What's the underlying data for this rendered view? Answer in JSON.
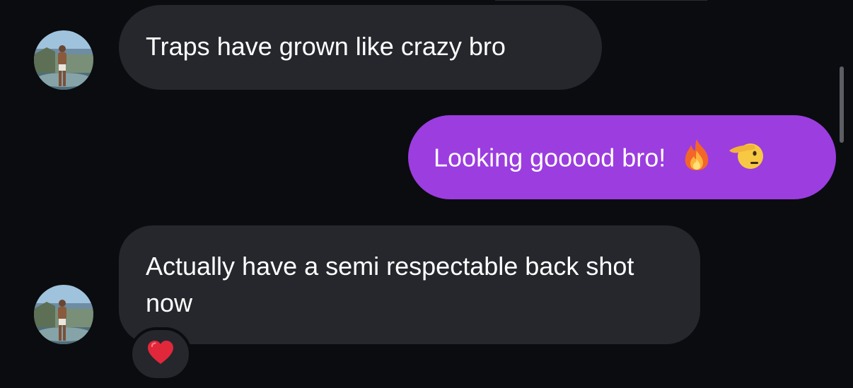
{
  "messages": [
    {
      "direction": "received",
      "text": "Traps have grown like crazy bro"
    },
    {
      "direction": "sent",
      "text": "Looking gooood bro!",
      "emojis": [
        "fire-icon",
        "saluting-face-icon"
      ]
    },
    {
      "direction": "received",
      "text": "Actually have a semi respectable back shot now",
      "reaction": "red-heart-icon"
    }
  ],
  "colors": {
    "background": "#0b0c10",
    "received_bubble": "#25272d",
    "sent_bubble": "#9c3de0",
    "text": "#ffffff"
  }
}
